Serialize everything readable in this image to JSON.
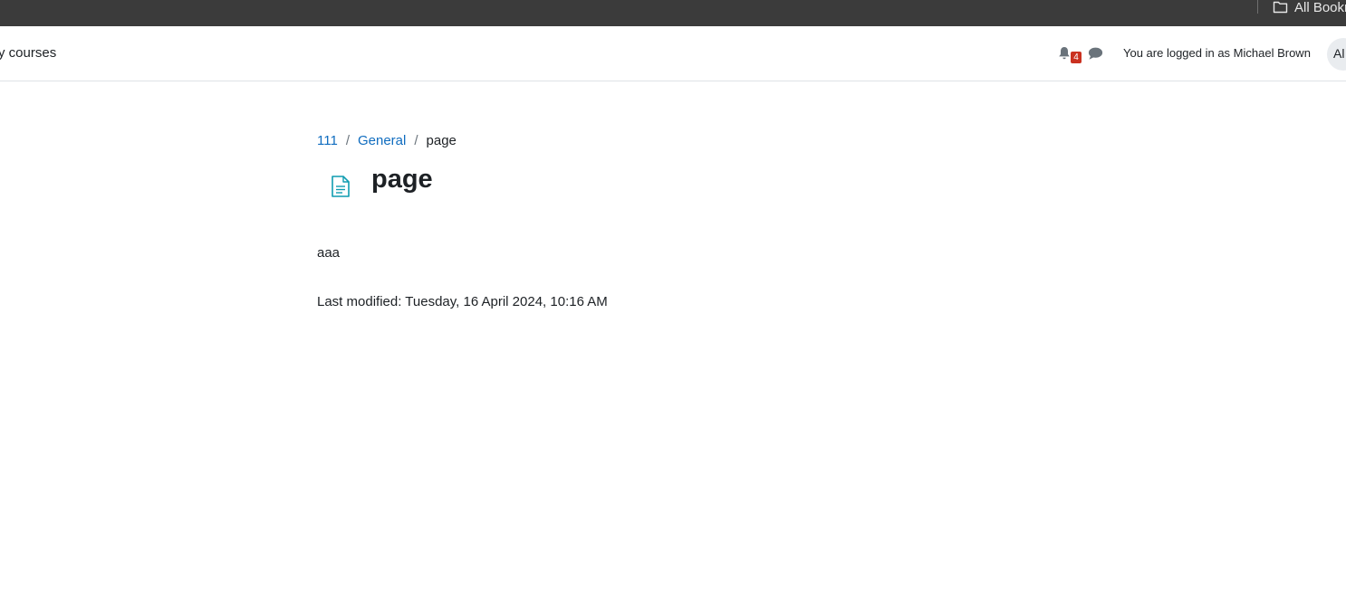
{
  "browser": {
    "bookmark_folder_label": "All Bookmarks"
  },
  "navbar": {
    "my_courses_label": "y courses",
    "notification_count": "4",
    "logged_in_text": "You are logged in as Michael Brown",
    "avatar_initials": "Al"
  },
  "breadcrumb": {
    "items": [
      {
        "label": "111"
      },
      {
        "label": "General"
      },
      {
        "label": "page"
      }
    ],
    "separator": "/"
  },
  "page": {
    "title": "page",
    "content": "aaa",
    "last_modified": "Last modified: Tuesday, 16 April 2024, 10:16 AM"
  },
  "icons": {
    "bookmark_folder": "folder-icon",
    "notifications": "bell-icon",
    "messages": "chat-bubble-icon",
    "activity": "page-document-icon"
  },
  "colors": {
    "link": "#0f6cbf",
    "badge": "#ca3120",
    "activity_icon": "#0f9cb0",
    "bookmarks_bar": "#3b3b3b"
  }
}
